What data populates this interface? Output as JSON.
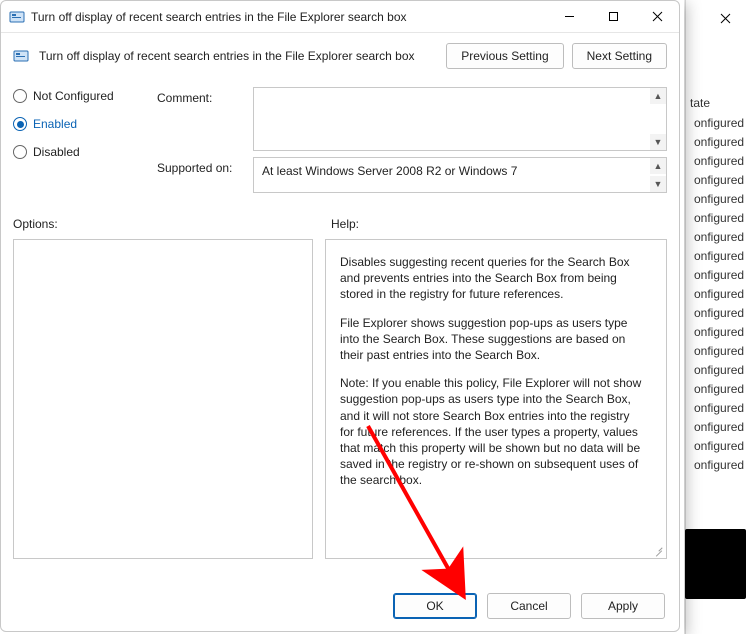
{
  "bgwin": {
    "header": "tate",
    "items": [
      "onfigured",
      "onfigured",
      "onfigured",
      "onfigured",
      "onfigured",
      "onfigured",
      "onfigured",
      "onfigured",
      "onfigured",
      "onfigured",
      "onfigured",
      "onfigured",
      "onfigured",
      "onfigured",
      "onfigured",
      "onfigured",
      "onfigured",
      "onfigured",
      "onfigured"
    ]
  },
  "dialog": {
    "title": "Turn off display of recent search entries in the File Explorer search box",
    "subtitle": "Turn off display of recent search entries in the File Explorer search box",
    "prev_btn": "Previous Setting",
    "next_btn": "Next Setting",
    "radios": {
      "not_configured": "Not Configured",
      "enabled": "Enabled",
      "disabled": "Disabled",
      "selected": "enabled"
    },
    "comment_label": "Comment:",
    "comment_value": "",
    "supported_label": "Supported on:",
    "supported_value": "At least Windows Server 2008 R2 or Windows 7",
    "options_label": "Options:",
    "help_label": "Help:",
    "help_paras": [
      "Disables suggesting recent queries for the Search Box and prevents entries into the Search Box from being stored in the registry for future references.",
      "File Explorer shows suggestion pop-ups as users type into the Search Box.  These suggestions are based on their past entries into the Search Box.",
      "Note: If you enable this policy, File Explorer will not show suggestion pop-ups as users type into the Search Box, and it will not store Search Box entries into the registry for future references.  If the user types a property, values that match this property will be shown but no data will be saved in the registry or re-shown on subsequent uses of the search box."
    ],
    "ok": "OK",
    "cancel": "Cancel",
    "apply": "Apply"
  }
}
